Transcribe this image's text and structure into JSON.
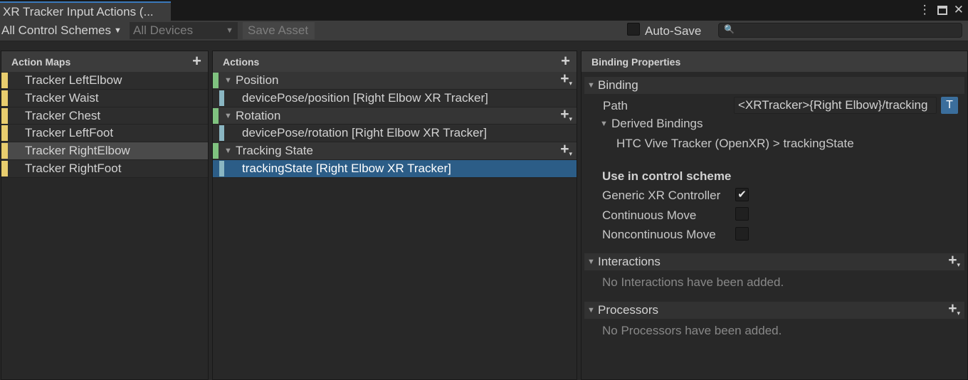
{
  "window": {
    "tab_title": "XR Tracker Input Actions (...",
    "controls": {
      "menu_icon": "kebab-menu-icon",
      "maximize_icon": "maximize-icon",
      "close_icon": "close-icon"
    }
  },
  "toolbar": {
    "control_schemes": "All Control Schemes",
    "devices": "All Devices",
    "save_asset": "Save Asset",
    "auto_save_label": "Auto-Save",
    "auto_save_checked": false,
    "search_placeholder": ""
  },
  "action_maps": {
    "title": "Action Maps",
    "items": [
      {
        "label": "Tracker LeftElbow",
        "selected": false
      },
      {
        "label": "Tracker Waist",
        "selected": false
      },
      {
        "label": "Tracker Chest",
        "selected": false
      },
      {
        "label": "Tracker LeftFoot",
        "selected": false
      },
      {
        "label": "Tracker RightElbow",
        "selected": true
      },
      {
        "label": "Tracker RightFoot",
        "selected": false
      }
    ]
  },
  "actions": {
    "title": "Actions",
    "rows": [
      {
        "kind": "action",
        "label": "Position"
      },
      {
        "kind": "binding",
        "label": "devicePose/position [Right Elbow XR Tracker]"
      },
      {
        "kind": "action",
        "label": "Rotation"
      },
      {
        "kind": "binding",
        "label": "devicePose/rotation [Right Elbow XR Tracker]"
      },
      {
        "kind": "action",
        "label": "Tracking State"
      },
      {
        "kind": "binding",
        "label": "trackingState [Right Elbow XR Tracker]",
        "selected": true
      }
    ]
  },
  "properties": {
    "title": "Binding Properties",
    "binding_section": "Binding",
    "path_label": "Path",
    "path_value": "<XRTracker>{Right Elbow}/tracking",
    "t_button": "T",
    "derived_label": "Derived Bindings",
    "derived_item": "HTC Vive Tracker (OpenXR) > trackingState",
    "scheme_heading": "Use in control scheme",
    "schemes": [
      {
        "label": "Generic XR Controller",
        "checked": true
      },
      {
        "label": "Continuous Move",
        "checked": false
      },
      {
        "label": "Noncontinuous Move",
        "checked": false
      }
    ],
    "interactions_section": "Interactions",
    "interactions_empty": "No Interactions have been added.",
    "processors_section": "Processors",
    "processors_empty": "No Processors have been added."
  },
  "colors": {
    "accent_tab": "#3a79bb",
    "map_marker": "#e8cd6e",
    "action_marker": "#7fc27f",
    "binding_marker": "#8ab6c2",
    "selection": "#2c5d87"
  }
}
